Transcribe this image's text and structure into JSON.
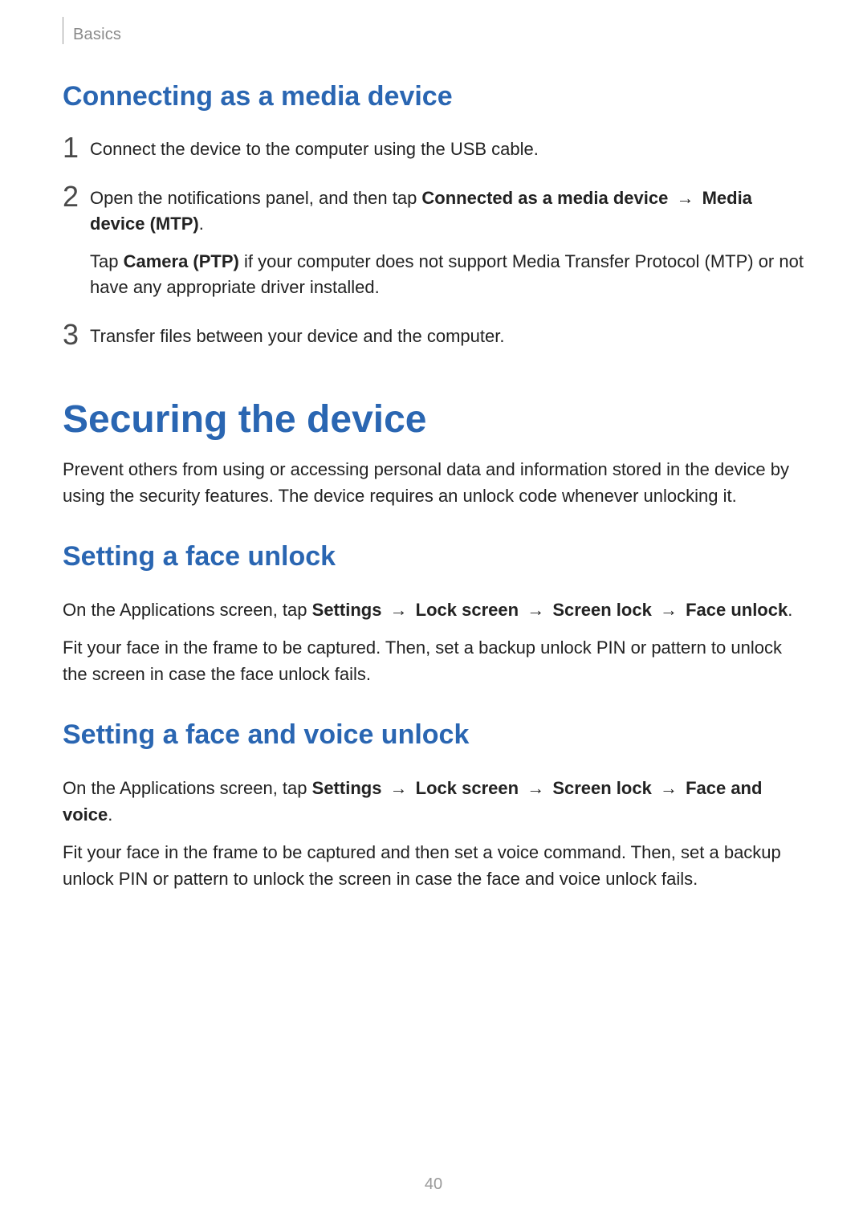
{
  "header": {
    "section": "Basics"
  },
  "connecting": {
    "title": "Connecting as a media device",
    "steps": {
      "s1": {
        "num": "1",
        "text": "Connect the device to the computer using the USB cable."
      },
      "s2": {
        "num": "2",
        "pre": "Open the notifications panel, and then tap ",
        "b1": "Connected as a media device",
        "arrow": " → ",
        "b2": "Media device (MTP)",
        "post": ".",
        "note_pre": "Tap ",
        "note_b": "Camera (PTP)",
        "note_post": " if your computer does not support Media Transfer Protocol (MTP) or not have any appropriate driver installed."
      },
      "s3": {
        "num": "3",
        "text": "Transfer files between your device and the computer."
      }
    }
  },
  "securing": {
    "title": "Securing the device",
    "intro": "Prevent others from using or accessing personal data and information stored in the device by using the security features. The device requires an unlock code whenever unlocking it.",
    "face": {
      "title": "Setting a face unlock",
      "line1_pre": "On the Applications screen, tap ",
      "b_settings": "Settings",
      "arrow": " → ",
      "b_lockscreen": "Lock screen",
      "b_screenlock": "Screen lock",
      "b_faceunlock": "Face unlock",
      "line1_post": ".",
      "line2": "Fit your face in the frame to be captured. Then, set a backup unlock PIN or pattern to unlock the screen in case the face unlock fails."
    },
    "facevoice": {
      "title": "Setting a face and voice unlock",
      "line1_pre": "On the Applications screen, tap ",
      "b_settings": "Settings",
      "arrow": " → ",
      "b_lockscreen": "Lock screen",
      "b_screenlock": "Screen lock",
      "b_facevoice": "Face and voice",
      "line1_post": ".",
      "line2": "Fit your face in the frame to be captured and then set a voice command. Then, set a backup unlock PIN or pattern to unlock the screen in case the face and voice unlock fails."
    }
  },
  "page_number": "40"
}
